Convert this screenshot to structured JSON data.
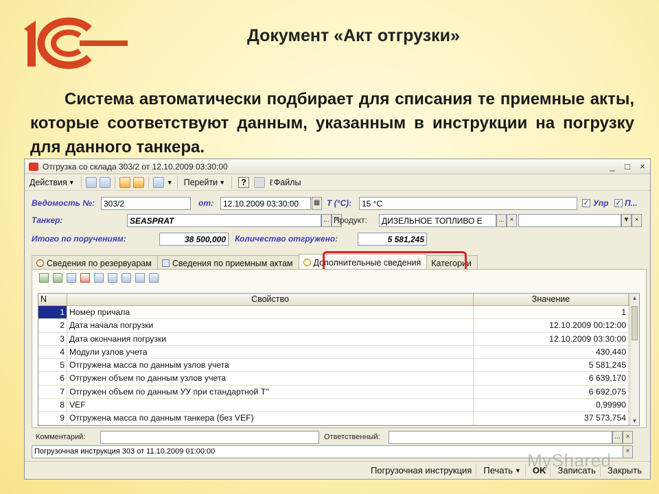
{
  "slide": {
    "title": "Документ «Акт отгрузки»",
    "text": "Система автоматически подбирает для списания те приемные акты, которые соответствуют данным, указанным в инструкции  на погрузку для данного танкера.",
    "logo_text": "1С",
    "watermark": "MyShared"
  },
  "window": {
    "title": "Отгрузка со склада 303/2 от 12.10.2009 03:30:00",
    "controls": [
      "_",
      "□",
      "×"
    ]
  },
  "toolbar": {
    "actions_label": "Действия",
    "goto_label": "Перейти",
    "help_label": "?",
    "files_label": "Файлы"
  },
  "form": {
    "statement_label": "Ведомость №:",
    "statement_value": "303/2",
    "from_label": "от:",
    "from_value": "12.10.2009 03:30:00",
    "temp_label": "T (°C):",
    "temp_value": "15 °C",
    "upr_label": "Упр",
    "p_label": "П...",
    "tanker_label": "Танкер:",
    "tanker_value": "SEASPRAT",
    "product_label": "Продукт:",
    "product_value": "ДИЗЕЛЬНОЕ ТОПЛИВО Е",
    "total_label": "Итого по поручениям:",
    "total_value": "38 500,000",
    "shipped_label": "Количество отгружено:",
    "shipped_value": "5 581,245"
  },
  "tabs": [
    {
      "label": "Сведения по резервуарам"
    },
    {
      "label": "Сведения по приемным актам"
    },
    {
      "label": "Дополнительные сведения"
    },
    {
      "label": "Категории"
    }
  ],
  "grid": {
    "headers": {
      "n": "N",
      "prop": "Свойство",
      "val": "Значение"
    },
    "rows": [
      {
        "n": "1",
        "prop": "Номер причала",
        "val": "1"
      },
      {
        "n": "2",
        "prop": "Дата начала погрузки",
        "val": "12.10.2009 00:12:00"
      },
      {
        "n": "3",
        "prop": "Дата окончания погрузки",
        "val": "12.10.2009 03:30:00"
      },
      {
        "n": "4",
        "prop": "Модули узлов учета",
        "val": "430,440"
      },
      {
        "n": "5",
        "prop": "Отгружена масса по данным узлов учета",
        "val": "5 581,245"
      },
      {
        "n": "6",
        "prop": "Отгружен объем по данным узлов учета",
        "val": "6 639,170"
      },
      {
        "n": "7",
        "prop": "Отгружен объем по данным УУ при стандартной Т\"",
        "val": "6 692,075"
      },
      {
        "n": "8",
        "prop": "VEF",
        "val": "0,99990"
      },
      {
        "n": "9",
        "prop": "Отгружена масса по данным танкера (без VEF)",
        "val": "37 573,754"
      }
    ]
  },
  "footer": {
    "comment_label": "Комментарий:",
    "comment_value": "",
    "responsible_label": "Ответственный:",
    "responsible_value": "",
    "instruction_value": "Погрузочная инструкция 303 от 11.10.2009 01:00:00"
  },
  "statusbar": {
    "instruction_btn": "Погрузочная инструкция",
    "print_btn": "Печать",
    "ok_btn": "OK",
    "save_btn": "Записать",
    "close_btn": "Закрыть"
  }
}
